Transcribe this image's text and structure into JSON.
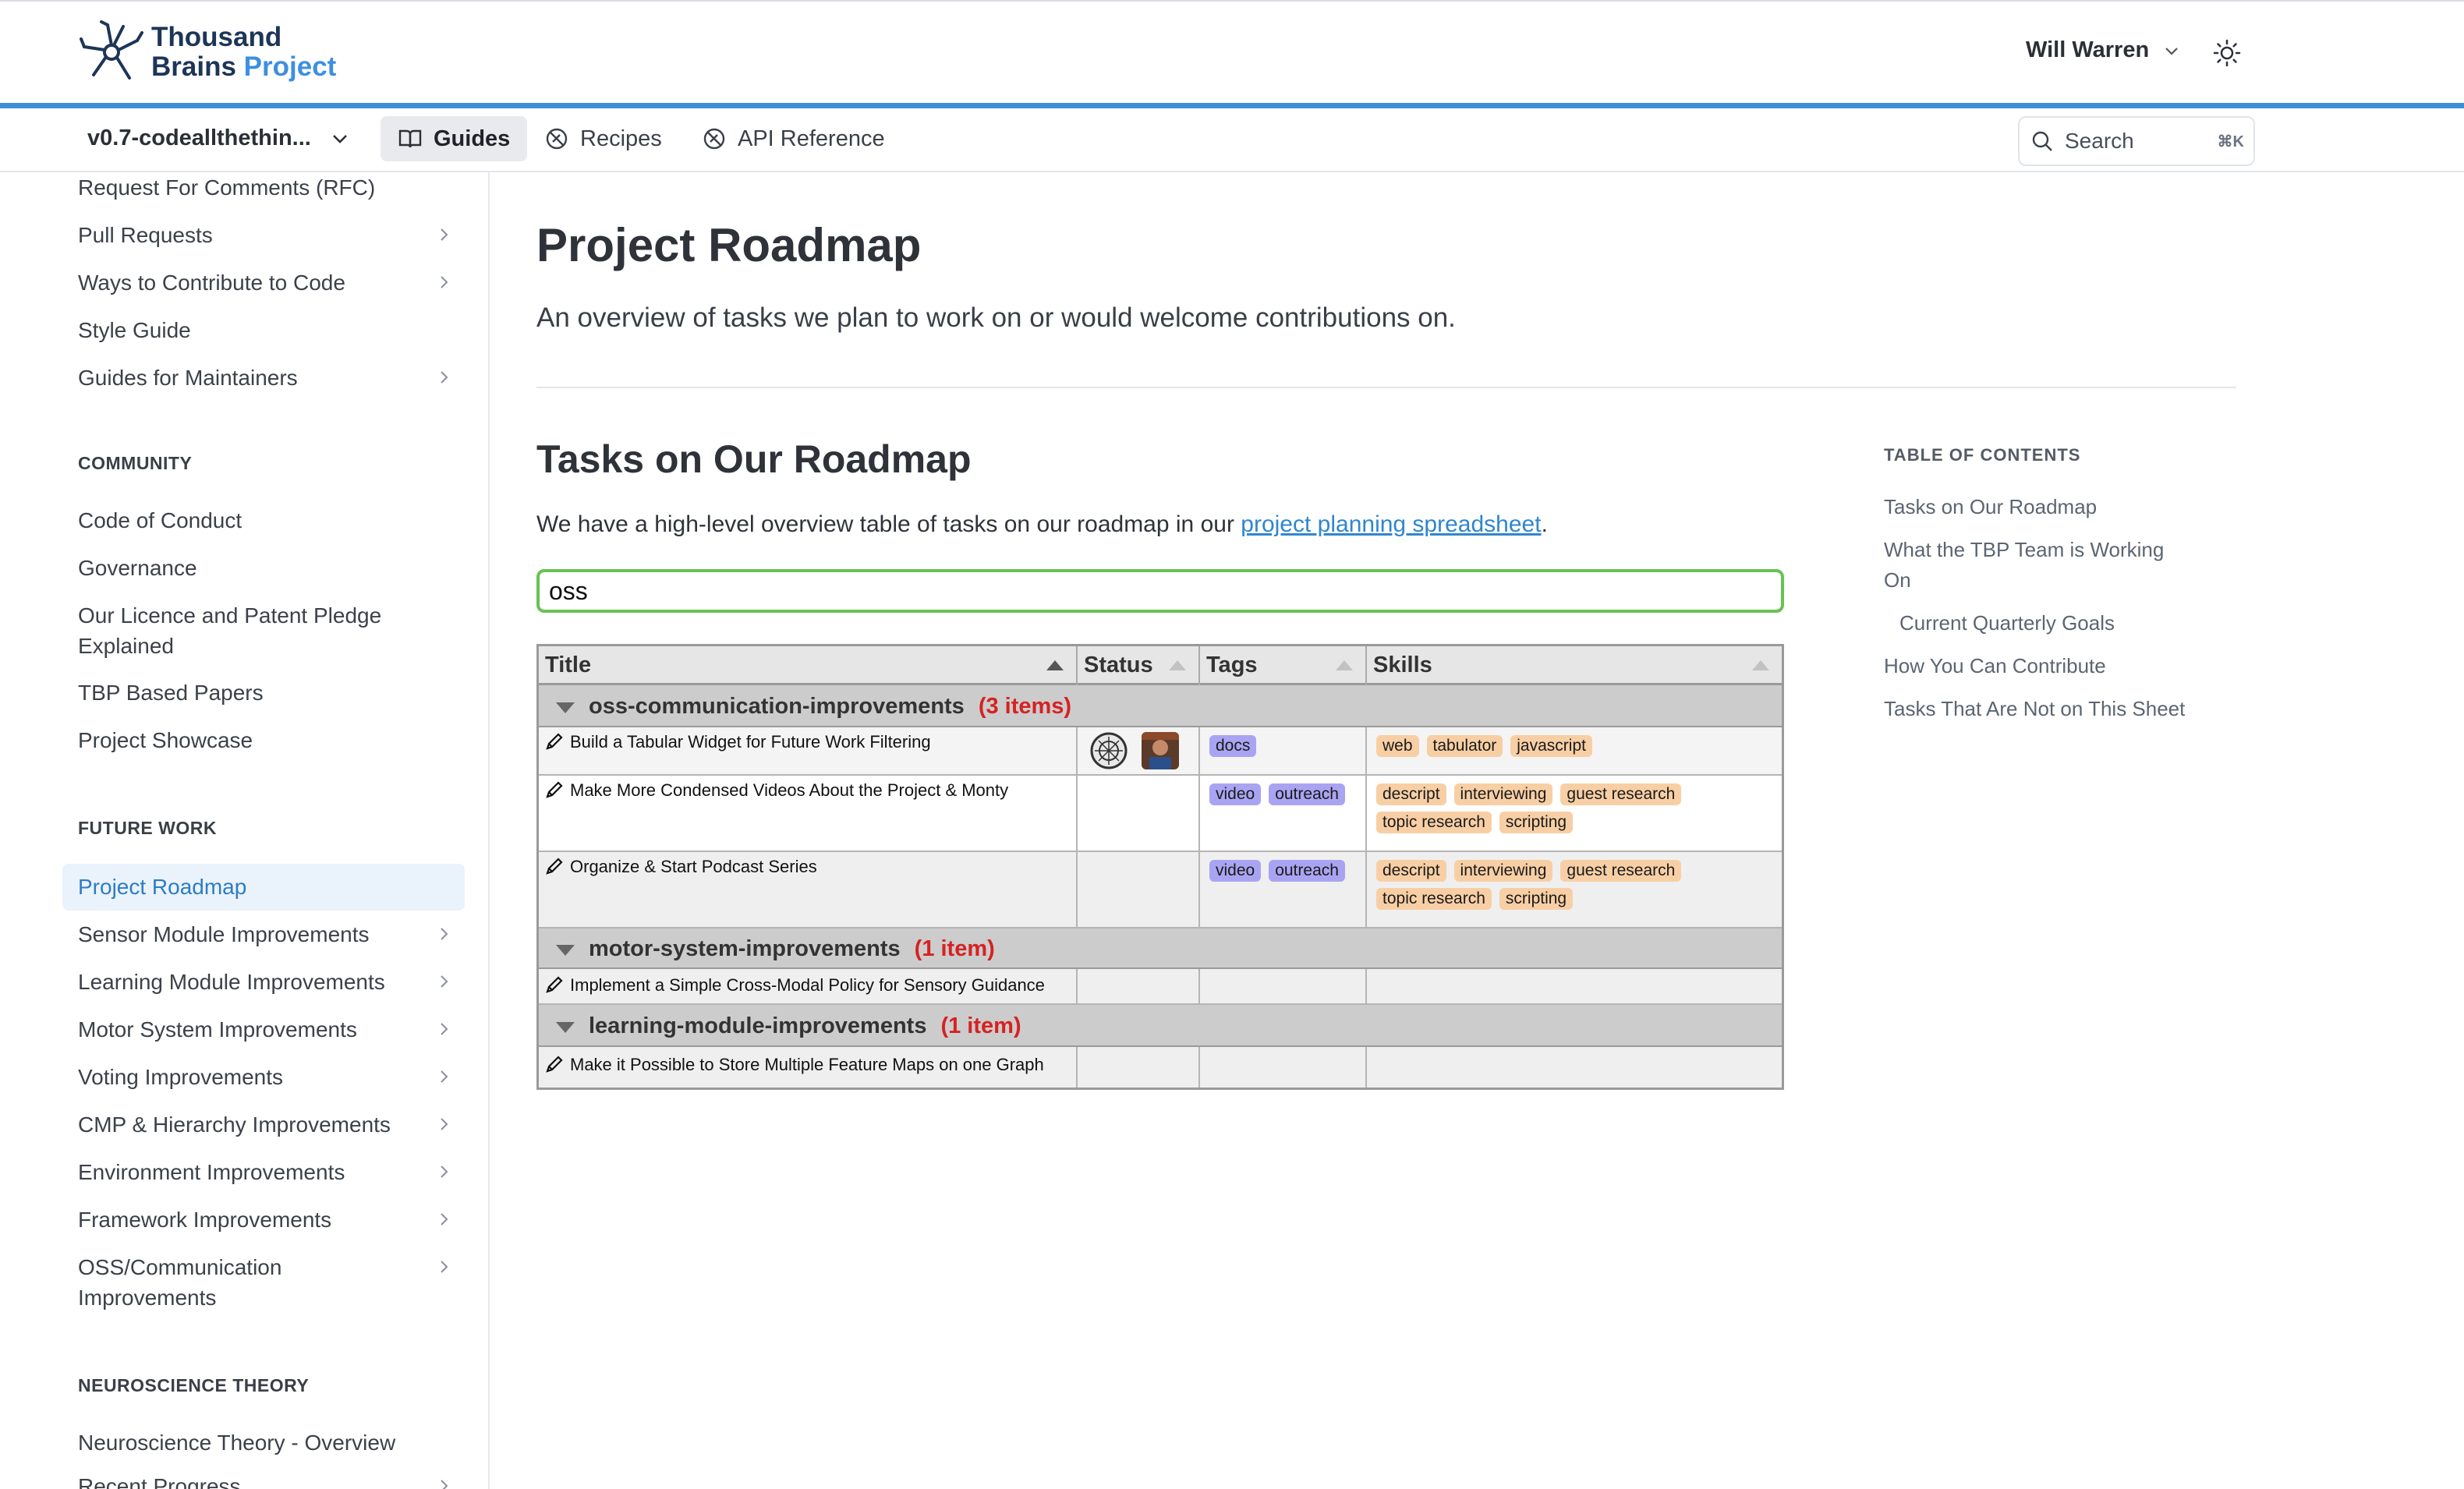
{
  "header": {
    "logo_line1": "Thousand",
    "logo_line2_a": "Brains",
    "logo_line2_b": "Project",
    "user_name": "Will Warren"
  },
  "subnav": {
    "version": "v0.7-codeallthethin...",
    "tabs": [
      "Guides",
      "Recipes",
      "API Reference"
    ],
    "search_placeholder": "Search",
    "search_shortcut": "⌘K"
  },
  "sidebar": {
    "items_top": [
      {
        "label": "Request For Comments (RFC)",
        "arrow": false
      },
      {
        "label": "Pull Requests",
        "arrow": true
      },
      {
        "label": "Ways to Contribute to Code",
        "arrow": true
      },
      {
        "label": "Style Guide",
        "arrow": false
      },
      {
        "label": "Guides for Maintainers",
        "arrow": true
      }
    ],
    "community_heading": "COMMUNITY",
    "community": [
      "Code of Conduct",
      "Governance",
      "Our Licence and Patent Pledge Explained",
      "TBP Based Papers",
      "Project Showcase"
    ],
    "future_heading": "FUTURE WORK",
    "future": [
      {
        "label": "Project Roadmap",
        "arrow": false
      },
      {
        "label": "Sensor Module Improvements",
        "arrow": true
      },
      {
        "label": "Learning Module Improvements",
        "arrow": true
      },
      {
        "label": "Motor System Improvements",
        "arrow": true
      },
      {
        "label": "Voting Improvements",
        "arrow": true
      },
      {
        "label": "CMP & Hierarchy Improvements",
        "arrow": true
      },
      {
        "label": "Environment Improvements",
        "arrow": true
      },
      {
        "label": "Framework Improvements",
        "arrow": true
      },
      {
        "label": "OSS/Communication Improvements",
        "arrow": true
      }
    ],
    "neuro_heading": "NEUROSCIENCE THEORY",
    "neuro": [
      "Neuroscience Theory - Overview",
      "Recent Progress"
    ]
  },
  "main": {
    "title": "Project Roadmap",
    "lead": "An overview of tasks we plan to work on or would welcome contributions on.",
    "section_title": "Tasks on Our Roadmap",
    "para_before": "We have a high-level overview table of tasks on our roadmap in our ",
    "para_link": "project planning spreadsheet",
    "para_after": ".",
    "filter_value": "oss"
  },
  "table": {
    "columns": [
      "Title",
      "Status",
      "Tags",
      "Skills"
    ],
    "groups": [
      {
        "name": "oss-communication-improvements",
        "count": "(3 items)",
        "rows": [
          {
            "title": "Build a Tabular Widget for Future Work Filtering",
            "tags": [
              "docs"
            ],
            "skills": [
              "web",
              "tabulator",
              "javascript"
            ]
          },
          {
            "title": "Make More Condensed Videos About the Project & Monty",
            "tags": [
              "video",
              "outreach"
            ],
            "skills": [
              "descript",
              "interviewing",
              "guest research",
              "topic research",
              "scripting"
            ]
          },
          {
            "title": "Organize & Start Podcast Series",
            "tags": [
              "video",
              "outreach"
            ],
            "skills": [
              "descript",
              "interviewing",
              "guest research",
              "topic research",
              "scripting"
            ]
          }
        ]
      },
      {
        "name": "motor-system-improvements",
        "count": "(1 item)",
        "rows": [
          {
            "title": "Implement a Simple Cross-Modal Policy for Sensory Guidance",
            "tags": [],
            "skills": []
          }
        ]
      },
      {
        "name": "learning-module-improvements",
        "count": "(1 item)",
        "rows": [
          {
            "title": "Make it Possible to Store Multiple Feature Maps on one Graph",
            "tags": [],
            "skills": []
          }
        ]
      }
    ]
  },
  "toc": {
    "heading": "TABLE OF CONTENTS",
    "items": [
      "Tasks on Our Roadmap",
      "What the TBP Team is Working On",
      "Current Quarterly Goals",
      "How You Can Contribute",
      "Tasks That Are Not on This Sheet"
    ]
  },
  "colors": {
    "accent": "#3d8fd6",
    "link": "#2f86cf",
    "active_nav_bg": "#eaf3fb",
    "filter_border": "#67c254",
    "tag_pill": "#a9a4f2",
    "skill_pill": "#f8cfa5",
    "group_count": "#d62222"
  },
  "icons": [
    "neuron-logo-icon",
    "chevron-down-icon",
    "sun-icon",
    "book-icon",
    "recipe-icon",
    "api-icon",
    "search-icon",
    "chevron-right-icon",
    "pencil-icon",
    "sort-arrow-icon",
    "collapse-triangle-icon"
  ]
}
